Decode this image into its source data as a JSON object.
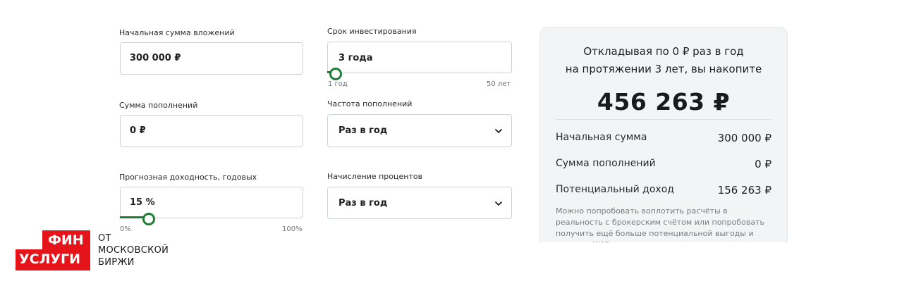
{
  "form": {
    "initial_amount": {
      "label": "Начальная сумма вложений",
      "value": "300 000 ₽"
    },
    "term": {
      "label": "Срок инвестирования",
      "value": "3 года",
      "range_min": "1 год",
      "range_max": "50 лет",
      "slider_fraction": 0.04
    },
    "contributions": {
      "label": "Сумма пополнений",
      "value": "0 ₽"
    },
    "frequency": {
      "label": "Частота пополнений",
      "value": "Раз в год"
    },
    "yield": {
      "label": "Прогнозная доходность, годовых",
      "value": "15 %",
      "range_min": "0%",
      "range_max": "100%",
      "slider_fraction": 0.15
    },
    "interest": {
      "label": "Начисление процентов",
      "value": "Раз в год"
    }
  },
  "result": {
    "summary_line1": "Откладывая по 0 ₽ раз в год",
    "summary_line2": "на протяжении 3 лет, вы накопите",
    "total": "456 263 ₽",
    "rows": [
      {
        "label": "Начальная сумма",
        "value": "300 000 ₽"
      },
      {
        "label": "Сумма пополнений",
        "value": "0 ₽"
      },
      {
        "label": "Потенциальный доход",
        "value": "156 263 ₽"
      }
    ],
    "note": "Можно попробовать воплотить расчёты в реальность с брокерским счётом или попробовать получить ещё больше потенциальной выгоды и открыть ИИС"
  },
  "logo": {
    "word1": "ФИН",
    "word2": "УСЛУГИ",
    "sub1": "ОТ",
    "sub2": "МОСКОВСКОЙ",
    "sub3": "БИРЖИ",
    "brand_color": "#e5141b"
  },
  "colors": {
    "accent": "#1e7e34",
    "card_bg": "#f3f4f6"
  }
}
